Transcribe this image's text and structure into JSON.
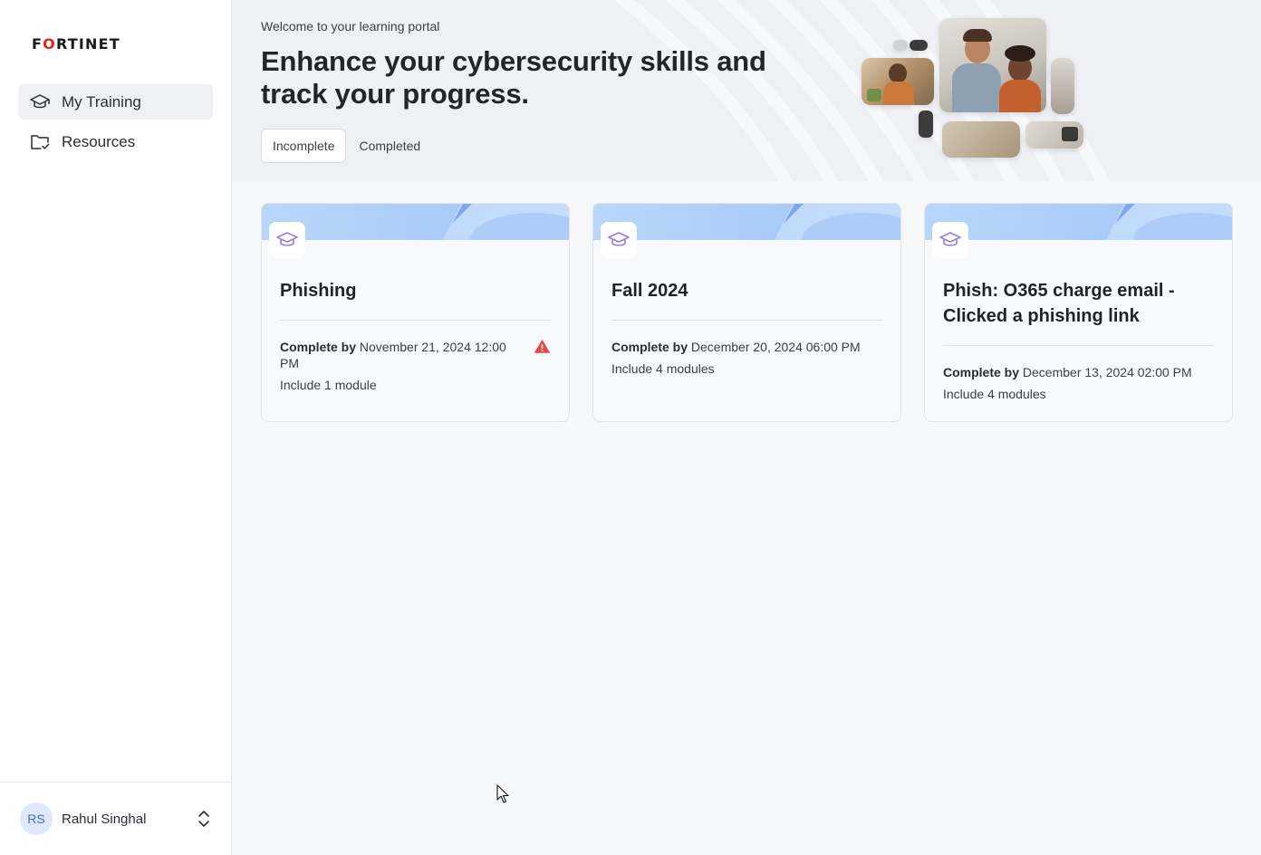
{
  "brand": {
    "logo_text": "FORTINET",
    "accent_color": "#da291c"
  },
  "sidebar": {
    "items": [
      {
        "label": "My Training",
        "icon": "graduation-cap-icon",
        "active": true
      },
      {
        "label": "Resources",
        "icon": "folder-check-icon",
        "active": false
      }
    ]
  },
  "user": {
    "initials": "RS",
    "name": "Rahul Singhal"
  },
  "hero": {
    "welcome": "Welcome to your learning portal",
    "headline": "Enhance your cybersecurity skills and track your progress.",
    "tabs": [
      {
        "label": "Incomplete",
        "active": true
      },
      {
        "label": "Completed",
        "active": false
      }
    ]
  },
  "cards": [
    {
      "title": "Phishing",
      "due_prefix": "Complete by",
      "due_date": "November 21, 2024 12:00 PM",
      "modules": "Include 1 module",
      "warning": true
    },
    {
      "title": "Fall 2024",
      "due_prefix": "Complete by",
      "due_date": "December 20, 2024 06:00 PM",
      "modules": "Include 4 modules",
      "warning": false
    },
    {
      "title": "Phish: O365 charge email - Clicked a phishing link",
      "due_prefix": "Complete by",
      "due_date": "December 13, 2024 02:00 PM",
      "modules": "Include 4 modules",
      "warning": false
    }
  ],
  "colors": {
    "warning": "#e5484d",
    "card_icon": "#9b7be0",
    "banner": "#b4d2fa"
  }
}
